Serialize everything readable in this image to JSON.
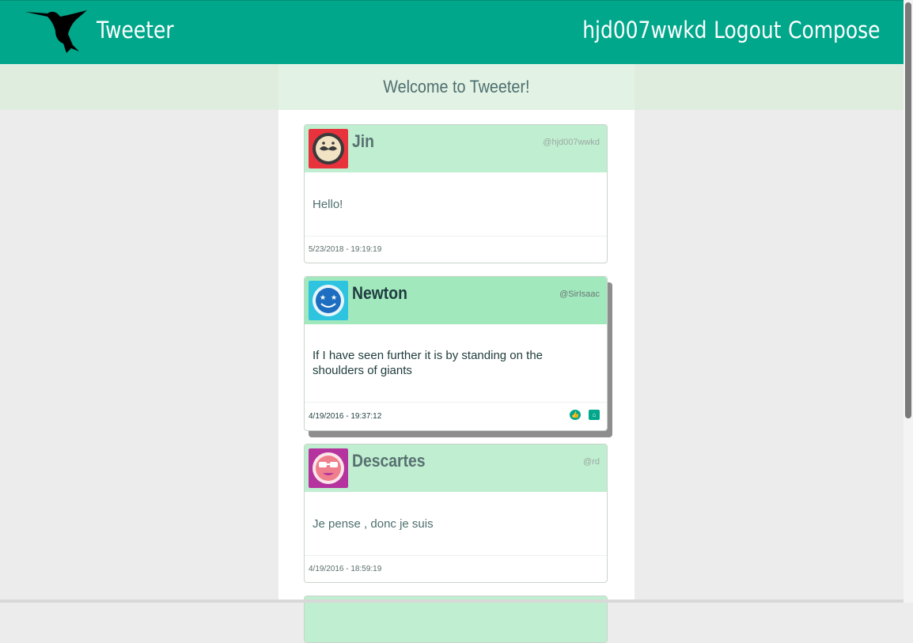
{
  "header": {
    "brand": "Tweeter",
    "username": "hjd007wwkd",
    "logout_label": "Logout",
    "compose_label": "Compose",
    "bg_color": "#00a78b",
    "logo_icon": "hummingbird-icon"
  },
  "welcome": "Welcome to Tweeter!",
  "tweets": [
    {
      "name": "Jin",
      "handle": "@hjd007wwkd",
      "text": "Hello!",
      "timestamp": "5/23/2018 - 19:19:19",
      "avatar_color": "#e8323c",
      "avatar_icon": "mustache-face-icon"
    },
    {
      "name": "Newton",
      "handle": "@SirIsaac",
      "text": "If I have seen further it is by standing on the shoulders of giants",
      "timestamp": "4/19/2016 - 19:37:12",
      "avatar_color": "#2ec4e0",
      "avatar_icon": "star-eyes-face-icon",
      "actions": [
        "like-icon",
        "delete-icon"
      ]
    },
    {
      "name": "Descartes",
      "handle": "@rd",
      "text": "Je pense , donc je suis",
      "timestamp": "4/19/2016 - 18:59:19",
      "avatar_color": "#b5339e",
      "avatar_icon": "sunglasses-face-icon"
    }
  ]
}
